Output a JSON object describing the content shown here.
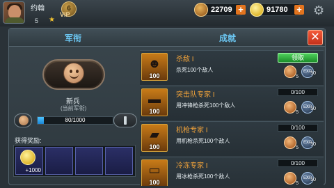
{
  "player": {
    "name": "约翰",
    "level": "5",
    "vip_level": "6",
    "vip_label": "VIP"
  },
  "resources": [
    {
      "name": "medal-currency",
      "value": "22709",
      "plus": "+"
    },
    {
      "name": "gold-coins",
      "value": "91780",
      "plus": "+"
    }
  ],
  "panel": {
    "tab_rank": "军衔",
    "tab_achievements": "成就",
    "close": "✕"
  },
  "rank": {
    "name": "新兵",
    "subtitle": "(当前军衔)",
    "exp_progress": 0.08,
    "exp_text": "80/1000",
    "reward_label": "获得奖励:",
    "rewards": [
      {
        "icon": "gold-coin-icon",
        "qty": "+1000"
      }
    ]
  },
  "achievements": [
    {
      "title": "杀敌 I",
      "desc": "杀死100个敌人",
      "icon": "enemy-silhouette-icon",
      "icon_num": "100",
      "status": "领取",
      "rank_reward": "5",
      "exp_reward": "50"
    },
    {
      "title": "突击队专家 I",
      "desc": "用冲锋枪杀死100个敌人",
      "icon": "smg-icon",
      "icon_num": "100",
      "progress": "0/100",
      "rank_reward": "5",
      "exp_reward": "50"
    },
    {
      "title": "机枪专家 I",
      "desc": "用机枪杀死100个敌人",
      "icon": "machine-gun-icon",
      "icon_num": "100",
      "progress": "0/100",
      "rank_reward": "5",
      "exp_reward": "50"
    },
    {
      "title": "冷冻专家 I",
      "desc": "用冰枪杀死100个敌人",
      "icon": "freeze-gun-icon",
      "icon_num": "100",
      "progress": "0/100",
      "rank_reward": "5",
      "exp_reward": "50"
    }
  ],
  "exp_badge_label": "EXP"
}
